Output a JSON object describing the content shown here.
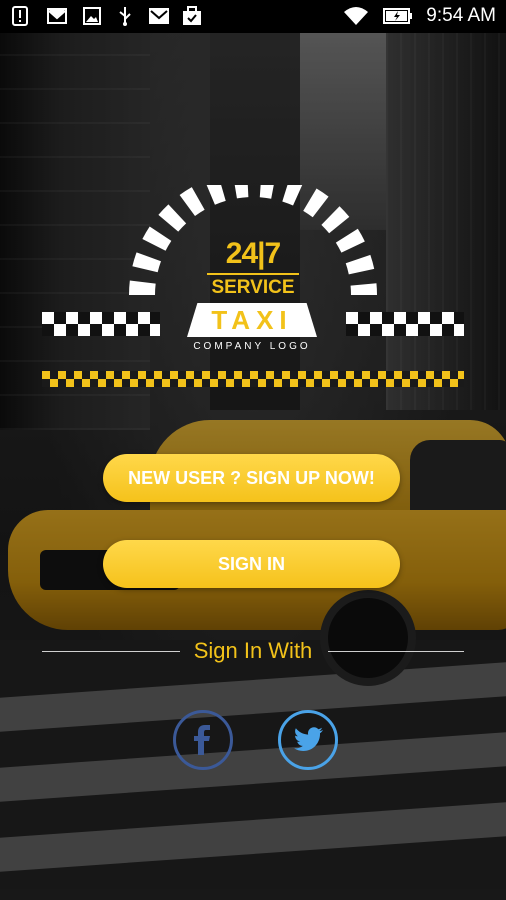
{
  "status_bar": {
    "time": "9:54 AM",
    "icons": [
      "alert-icon",
      "mail-icon",
      "image-icon",
      "usb-icon",
      "mail-icon",
      "briefcase-icon",
      "wifi-icon",
      "battery-icon"
    ]
  },
  "logo": {
    "number": "24|7",
    "service": "SERVICE",
    "taxi": "TAXI",
    "tagline": "COMPANY LOGO",
    "accent_color": "#f2c21a"
  },
  "buttons": {
    "signup_label": "NEW USER ? SIGN UP NOW!",
    "signin_label": "SIGN IN"
  },
  "social": {
    "heading": "Sign In With",
    "facebook_icon": "facebook-icon",
    "twitter_icon": "twitter-icon"
  }
}
